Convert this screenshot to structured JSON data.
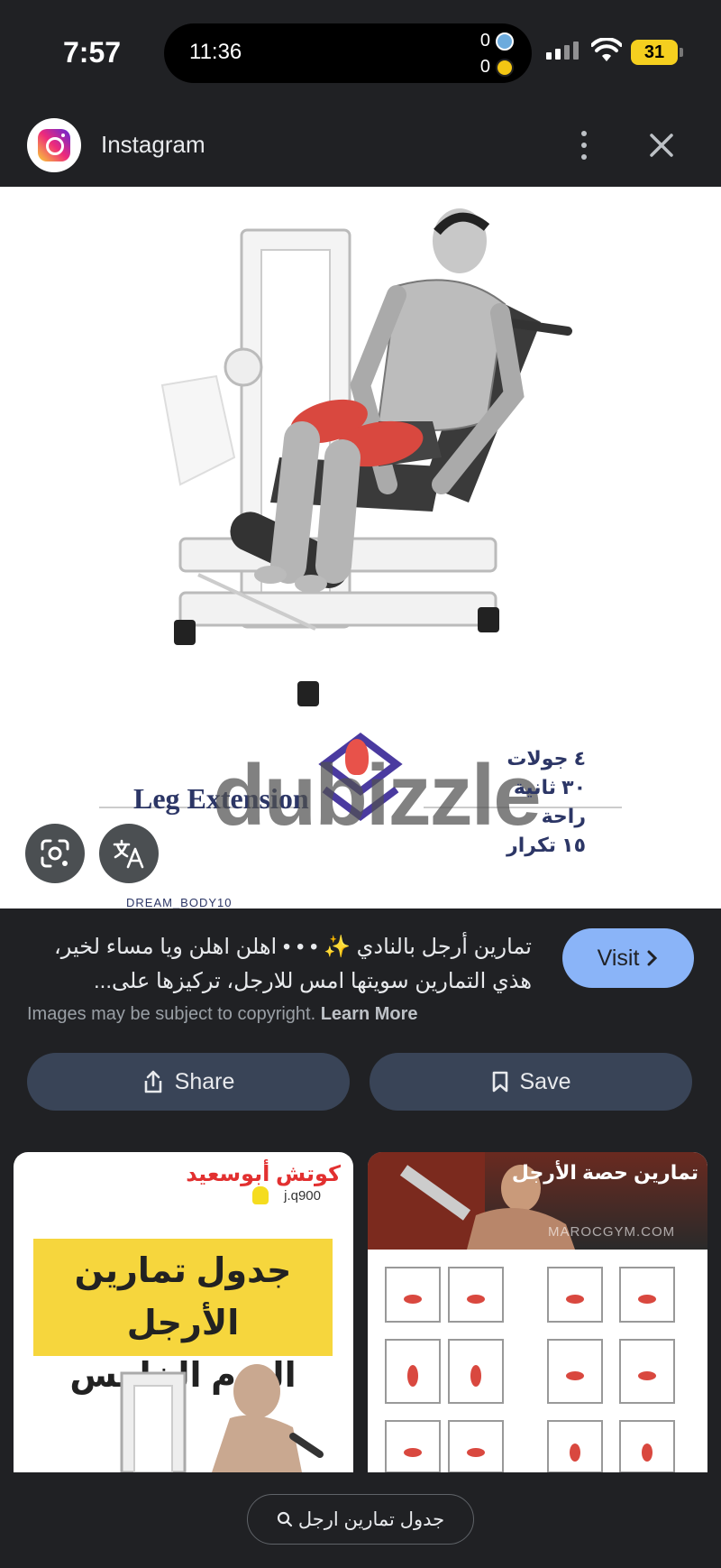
{
  "status_bar": {
    "time": "7:57",
    "live_activity_time": "11:36",
    "score_home": "0",
    "score_away": "0",
    "battery": "31"
  },
  "header": {
    "title": "Instagram"
  },
  "image": {
    "exercise_label": "Leg Extension",
    "watermark": "dubizzle",
    "info_lines": [
      "٤ جولات",
      "٣٠ ثانية راحة",
      "١٥ تكرار"
    ],
    "handle": "DREAM_BODY10"
  },
  "info": {
    "caption": "تمارين أرجل بالنادي ✨ • • • اهلن اهلن ويا مساء لخير، هذي التمارين سويتها امس للارجل، تركيزها على...",
    "visit_label": "Visit",
    "copyright_text": "Images may be subject to copyright.",
    "learn_more": "Learn More",
    "share_label": "Share",
    "save_label": "Save"
  },
  "related": [
    {
      "coach_name": "كوتش أبوسعيد",
      "handle": "j.q900",
      "line1": "جدول تمارين الأرجل",
      "line2": "اليوم الخامس"
    },
    {
      "title": "تمارين حصة الأرجل",
      "site": "MAROCGYM.COM"
    }
  ],
  "search_chip": {
    "query": "جدول تمارين ارجل"
  },
  "colors": {
    "background": "#202124",
    "visit_button": "#8ab4f8",
    "action_button": "#394457"
  }
}
